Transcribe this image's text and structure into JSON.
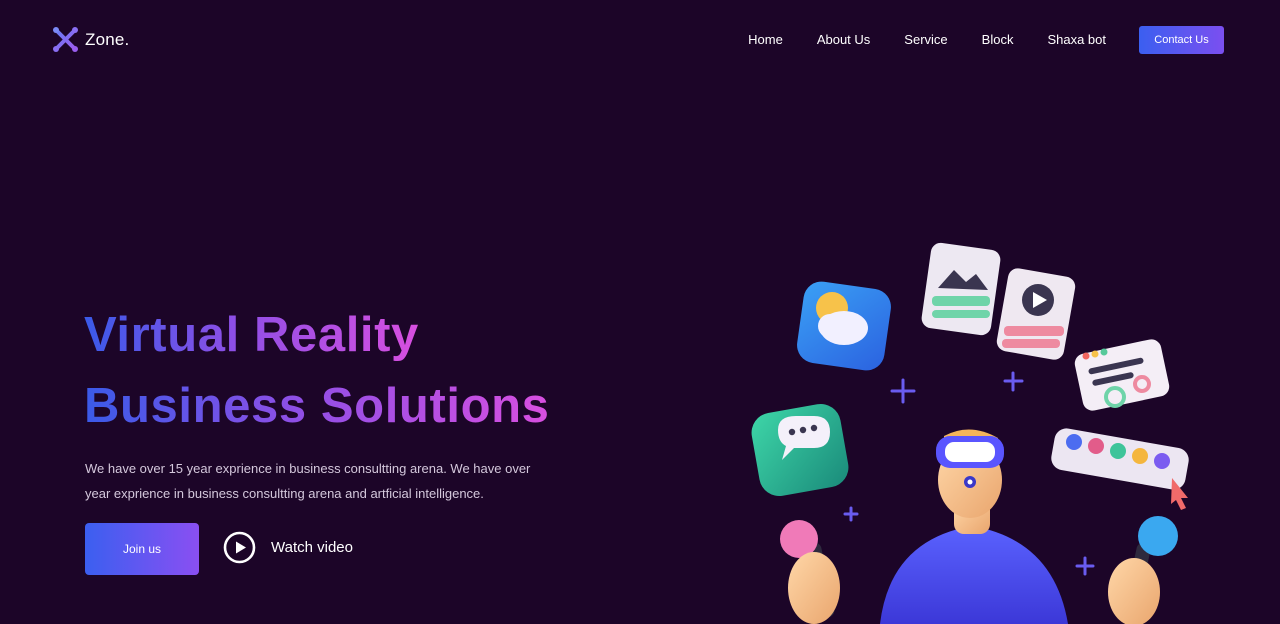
{
  "brand": {
    "name": "Zone."
  },
  "nav": {
    "items": [
      {
        "label": "Home"
      },
      {
        "label": "About Us"
      },
      {
        "label": "Service"
      },
      {
        "label": "Block"
      },
      {
        "label": "Shaxa bot"
      }
    ],
    "contact_label": "Contact Us"
  },
  "hero": {
    "title_line1": "Virtual Reality",
    "title_line2": "Business Solutions",
    "description": "We have over 15 year exprience in business consultting arena. We have over year exprience in business consultting arena and artficial intelligence.",
    "join_label": "Join us",
    "watch_label": "Watch video"
  },
  "colors": {
    "background": "#1c0528",
    "accent_start": "#3b5ff0",
    "accent_end": "#8a4ff2",
    "title_pink": "#d84fe0"
  },
  "icons": [
    "logo-x-icon",
    "play-circle-icon",
    "weather-icon",
    "image-icon",
    "video-icon",
    "chat-icon",
    "settings-card-icon",
    "color-palette-icon",
    "cursor-icon",
    "plus-icon"
  ]
}
